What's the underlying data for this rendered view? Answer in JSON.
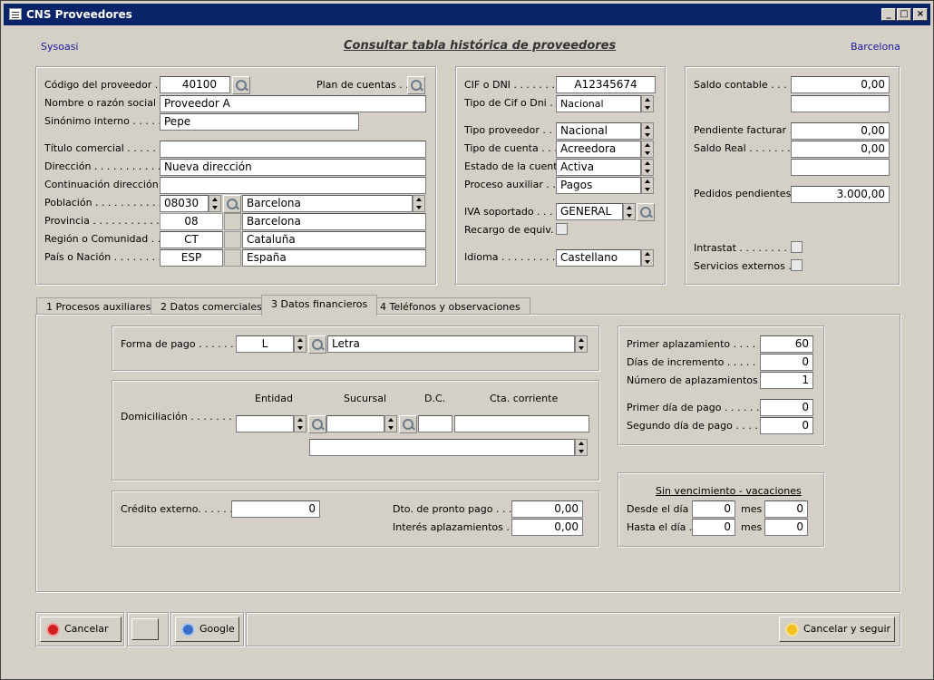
{
  "window": {
    "title": "CNS Proveedores",
    "min": "_",
    "max": "□",
    "close": "×"
  },
  "header": {
    "left": "Sysoasi",
    "title": "Consultar tabla histórica de proveedores",
    "right": "Barcelona"
  },
  "supplier": {
    "codigo_label": "Código del proveedor . .",
    "codigo": "40100",
    "plan_label": "Plan de cuentas . . .",
    "nombre_label": "Nombre o razón social .",
    "nombre": "Proveedor A",
    "sinonimo_label": "Sinónimo interno . . . . . .",
    "sinonimo": "Pepe",
    "titulo_label": "Título comercial . . . . . . .",
    "titulo": "",
    "direccion_label": "Dirección . . . . . . . . . . .",
    "direccion": "Nueva dirección",
    "cont_label": "Continuación dirección . .",
    "cont": "",
    "poblacion_label": "Población . . . . . . . . . . .",
    "cp": "08030",
    "poblacion": "Barcelona",
    "provincia_label": "Provincia . . . . . . . . . . .",
    "prov_code": "08",
    "provincia": "Barcelona",
    "region_label": "Región o Comunidad . . .",
    "region_code": "CT",
    "region": "Cataluña",
    "pais_label": "País o Nación . . . . . . . .",
    "pais_code": "ESP",
    "pais": "España"
  },
  "tax": {
    "cif_label": "CIF o DNI . . . . . . . .",
    "cif": "A12345674",
    "tipo_cif_label": "Tipo de Cif o Dni . .",
    "tipo_cif": "Nacional",
    "tipo_prov_label": "Tipo proveedor . . . .",
    "tipo_prov": "Nacional",
    "tipo_cuenta_label": "Tipo de cuenta . . . .",
    "tipo_cuenta": "Acreedora",
    "estado_label": "Estado de la cuenta .",
    "estado": "Activa",
    "proceso_label": "Proceso auxiliar . . .",
    "proceso": "Pagos",
    "iva_label": "IVA soportado . . . .",
    "iva": "GENERAL",
    "recargo_label": "Recargo de equiv. . .",
    "idioma_label": "Idioma . . . . . . . . . .",
    "idioma": "Castellano"
  },
  "balances": {
    "saldo_label": "Saldo contable . . . .",
    "saldo": "0,00",
    "saldo2": "",
    "pend_label": "Pendiente facturar .",
    "pend": "0,00",
    "real_label": "Saldo Real . . . . . . .",
    "real": "0,00",
    "real2": "",
    "pedidos_label": "Pedidos pendientes .",
    "pedidos": "3.000,00",
    "intrastat_label": "Intrastat . . . . . . . .",
    "servicios_label": "Servicios externos . ."
  },
  "tabs": [
    "1  Procesos auxiliares",
    "2  Datos comerciales",
    "3  Datos financieros",
    "4  Teléfonos y observaciones"
  ],
  "fin": {
    "forma_label": "Forma de pago . . . . . . .",
    "forma_code": "L",
    "forma": "Letra",
    "domic_label": "Domiciliación . . . . . . . . .",
    "entidad": "Entidad",
    "sucursal": "Sucursal",
    "dc": "D.C.",
    "cta": "Cta. corriente",
    "credito_label": "Crédito externo. . . . . . .",
    "credito": "0",
    "dto_label": "Dto. de pronto pago . . . .",
    "dto": "0,00",
    "interes_label": "Interés aplazamientos . . .",
    "interes": "0,00",
    "primer_apl_label": "Primer aplazamiento . . . . . .",
    "primer_apl": "60",
    "dias_inc_label": "Días de incremento . . . . . . .",
    "dias_inc": "0",
    "num_apl_label": "Número de aplazamientos . .",
    "num_apl": "1",
    "primer_dia_label": "Primer día de pago . . . . . . .",
    "primer_dia": "0",
    "segundo_dia_label": "Segundo día de pago . . . . .",
    "segundo_dia": "0",
    "vac_title": "Sin vencimiento - vacaciones",
    "desde_label": "Desde el día . .",
    "desde_dia": "0",
    "mes": "mes",
    "desde_mes": "0",
    "hasta_label": "Hasta el día . .",
    "hasta_dia": "0",
    "hasta_mes": "0"
  },
  "buttons": {
    "cancelar": "Cancelar",
    "google": "Google",
    "cancelar_seguir": "Cancelar y seguir"
  }
}
